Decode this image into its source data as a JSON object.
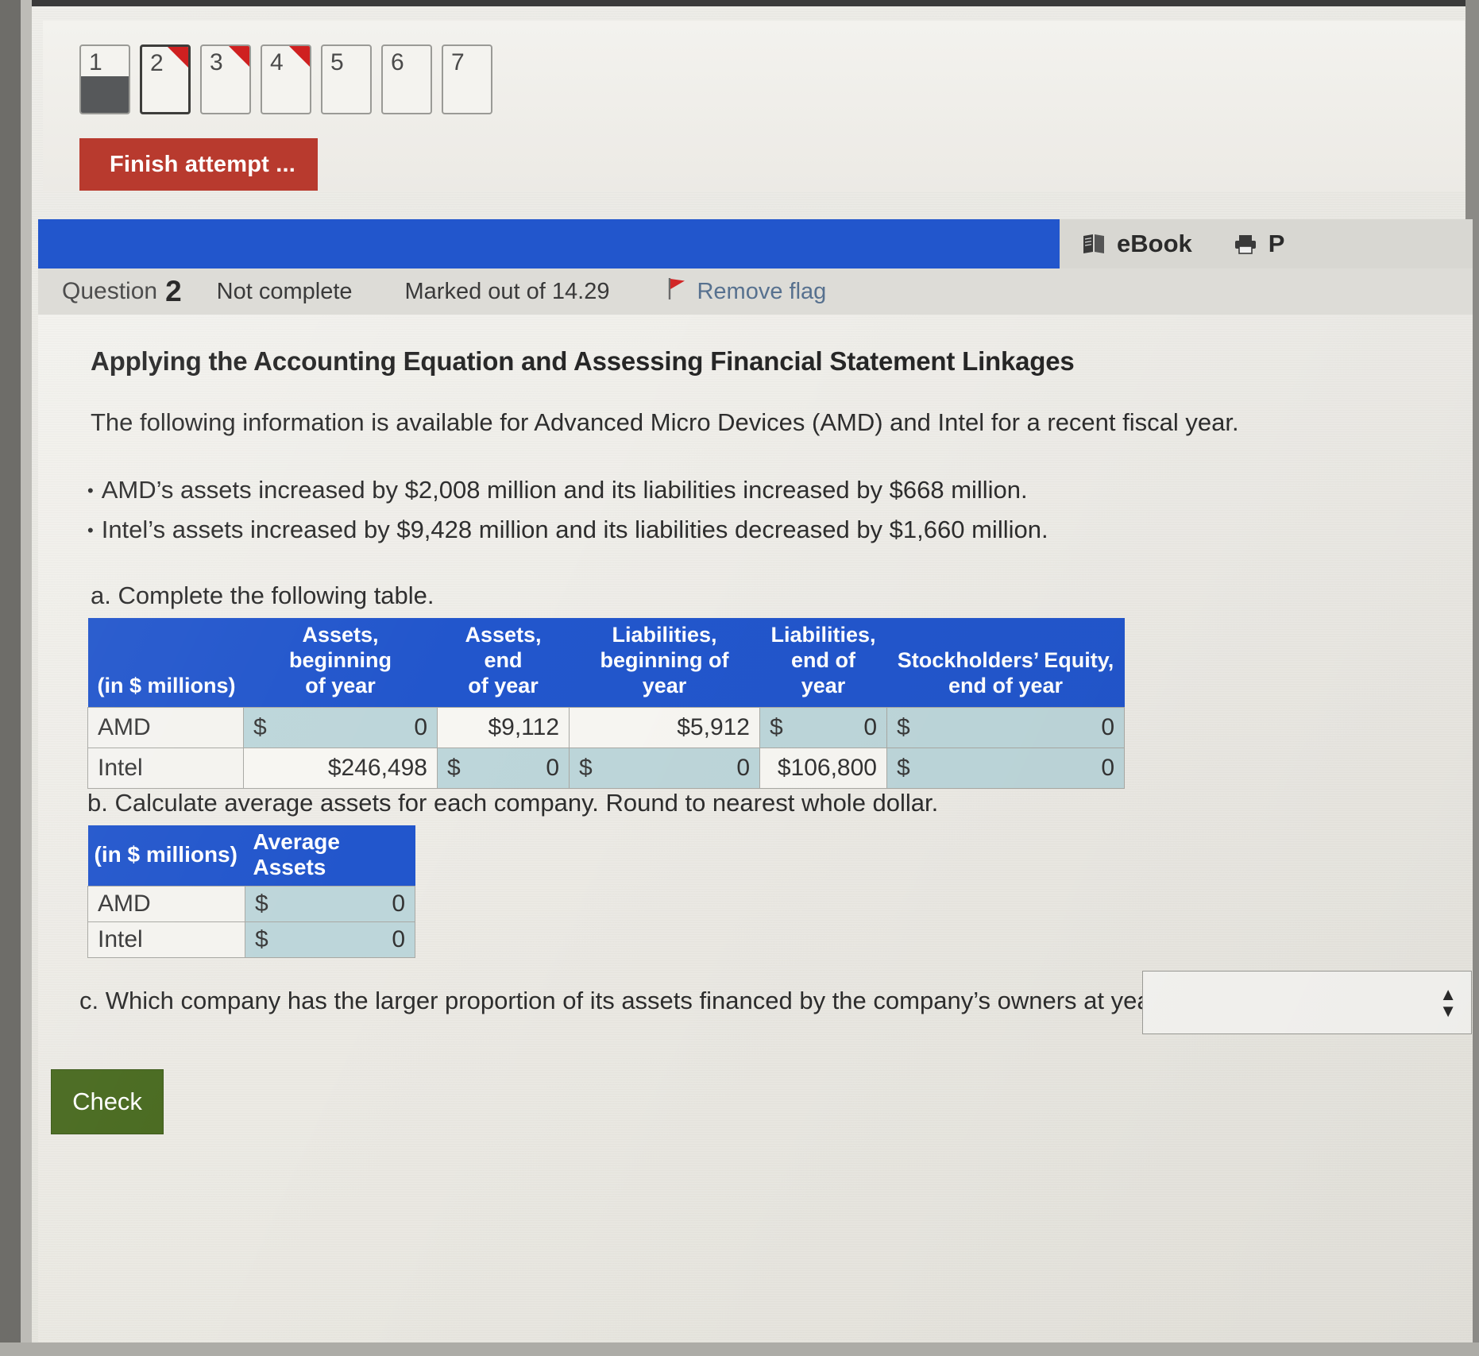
{
  "nav": {
    "questions": [
      {
        "number": "1",
        "answered": true,
        "flagged": false,
        "current": false
      },
      {
        "number": "2",
        "answered": false,
        "flagged": true,
        "current": true
      },
      {
        "number": "3",
        "answered": false,
        "flagged": true,
        "current": false
      },
      {
        "number": "4",
        "answered": false,
        "flagged": true,
        "current": false
      },
      {
        "number": "5",
        "answered": false,
        "flagged": false,
        "current": false
      },
      {
        "number": "6",
        "answered": false,
        "flagged": false,
        "current": false
      },
      {
        "number": "7",
        "answered": false,
        "flagged": false,
        "current": false
      }
    ],
    "finish_label": "Finish attempt ..."
  },
  "toolbar": {
    "ebook_label": "eBook",
    "print_label": "P",
    "ebook_icon": "book-icon",
    "print_icon": "printer-icon"
  },
  "question_meta": {
    "label": "Question",
    "number": "2",
    "state": "Not complete",
    "marks": "Marked out of 14.29",
    "flag_action": "Remove flag",
    "flag_icon": "red-flag-icon"
  },
  "question": {
    "title": "Applying the Accounting Equation and Assessing Financial Statement Linkages",
    "intro": "The following information is available for Advanced Micro Devices (AMD) and Intel for a recent fiscal year.",
    "bullets": [
      "AMD’s assets increased by $2,008 million and its liabilities increased by $668 million.",
      "Intel’s assets increased by $9,428 million and its liabilities decreased by $1,660 million."
    ],
    "part_a": "a. Complete the following table.",
    "part_b": "b. Calculate average assets for each company. Round to nearest whole dollar.",
    "part_c": "c. Which company has the larger proportion of its assets financed by the company’s owners at year-end?"
  },
  "table_main": {
    "headers": [
      "(in $ millions)",
      "Assets, beginning of year",
      "Assets, end of year",
      "Liabilities, beginning of year",
      "Liabilities, end of year",
      "Stockholders’ Equity, end of year"
    ],
    "header_lines": [
      [
        "",
        "(in $ millions)"
      ],
      [
        "Assets, beginning",
        "of year"
      ],
      [
        "Assets, end",
        "of year"
      ],
      [
        "Liabilities,",
        "beginning of year"
      ],
      [
        "Liabilities,",
        "end of year"
      ],
      [
        "Stockholders’ Equity,",
        "end of year"
      ]
    ],
    "rows": [
      {
        "label": "AMD",
        "cells": [
          {
            "type": "input",
            "prefix": "$",
            "value": "0"
          },
          {
            "type": "filled",
            "value": "$9,112"
          },
          {
            "type": "filled",
            "value": "$5,912"
          },
          {
            "type": "input",
            "prefix": "$",
            "value": "0"
          },
          {
            "type": "input",
            "prefix": "$",
            "value": "0"
          }
        ]
      },
      {
        "label": "Intel",
        "cells": [
          {
            "type": "filled",
            "value": "$246,498"
          },
          {
            "type": "input",
            "prefix": "$",
            "value": "0"
          },
          {
            "type": "input",
            "prefix": "$",
            "value": "0"
          },
          {
            "type": "filled",
            "value": "$106,800"
          },
          {
            "type": "input",
            "prefix": "$",
            "value": "0"
          }
        ]
      }
    ]
  },
  "table_avg": {
    "headers": [
      "(in $ millions)",
      "Average Assets"
    ],
    "rows": [
      {
        "label": "AMD",
        "cell": {
          "type": "input",
          "prefix": "$",
          "value": "0"
        }
      },
      {
        "label": "Intel",
        "cell": {
          "type": "input",
          "prefix": "$",
          "value": "0"
        }
      }
    ]
  },
  "part_c_select": {
    "value": "",
    "icon": "updown-arrows-icon"
  },
  "check_button": {
    "label": "Check"
  },
  "colors": {
    "header_blue": "#2256cc",
    "input_teal": "#bdd6da",
    "finish_red": "#b83a2e",
    "check_green": "#4a6b21",
    "flag_red": "#cf2020",
    "link_blue": "#57718f"
  }
}
